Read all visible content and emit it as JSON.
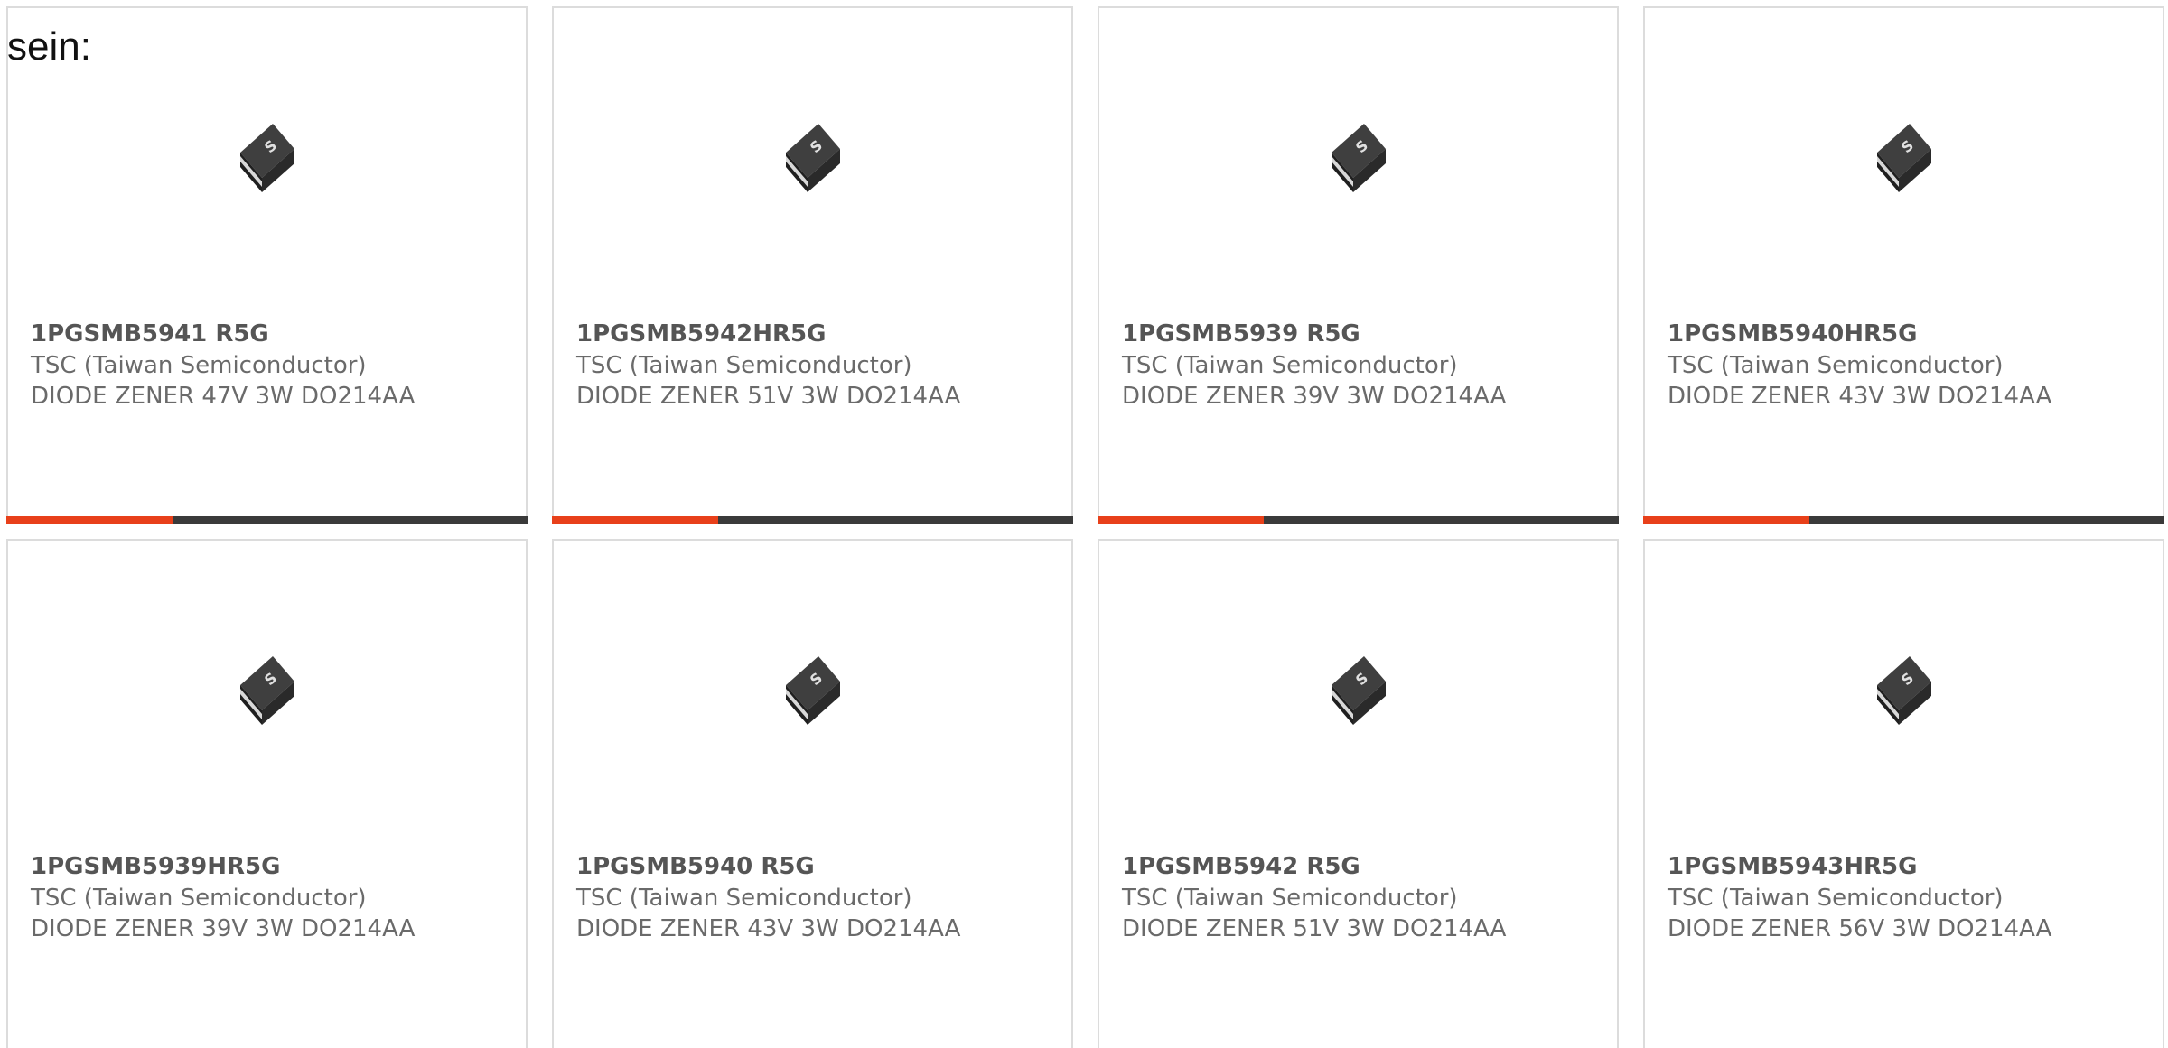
{
  "intro": {
    "text": "sein:"
  },
  "colors": {
    "accent": "#e8401a",
    "bar": "#3a3a3a",
    "border": "#dcdcdc"
  },
  "products": [
    {
      "part": "1PGSMB5941 R5G",
      "manufacturer": "TSC (Taiwan Semiconductor)",
      "description": "DIODE ZENER 47V 3W DO214AA",
      "icon": "smd-diode-icon"
    },
    {
      "part": "1PGSMB5942HR5G",
      "manufacturer": "TSC (Taiwan Semiconductor)",
      "description": "DIODE ZENER 51V 3W DO214AA",
      "icon": "smd-diode-icon"
    },
    {
      "part": "1PGSMB5939 R5G",
      "manufacturer": "TSC (Taiwan Semiconductor)",
      "description": "DIODE ZENER 39V 3W DO214AA",
      "icon": "smd-diode-icon"
    },
    {
      "part": "1PGSMB5940HR5G",
      "manufacturer": "TSC (Taiwan Semiconductor)",
      "description": "DIODE ZENER 43V 3W DO214AA",
      "icon": "smd-diode-icon"
    },
    {
      "part": "1PGSMB5939HR5G",
      "manufacturer": "TSC (Taiwan Semiconductor)",
      "description": "DIODE ZENER 39V 3W DO214AA",
      "icon": "smd-diode-icon"
    },
    {
      "part": "1PGSMB5940 R5G",
      "manufacturer": "TSC (Taiwan Semiconductor)",
      "description": "DIODE ZENER 43V 3W DO214AA",
      "icon": "smd-diode-icon"
    },
    {
      "part": "1PGSMB5942 R5G",
      "manufacturer": "TSC (Taiwan Semiconductor)",
      "description": "DIODE ZENER 51V 3W DO214AA",
      "icon": "smd-diode-icon"
    },
    {
      "part": "1PGSMB5943HR5G",
      "manufacturer": "TSC (Taiwan Semiconductor)",
      "description": "DIODE ZENER 56V 3W DO214AA",
      "icon": "smd-diode-icon"
    }
  ]
}
